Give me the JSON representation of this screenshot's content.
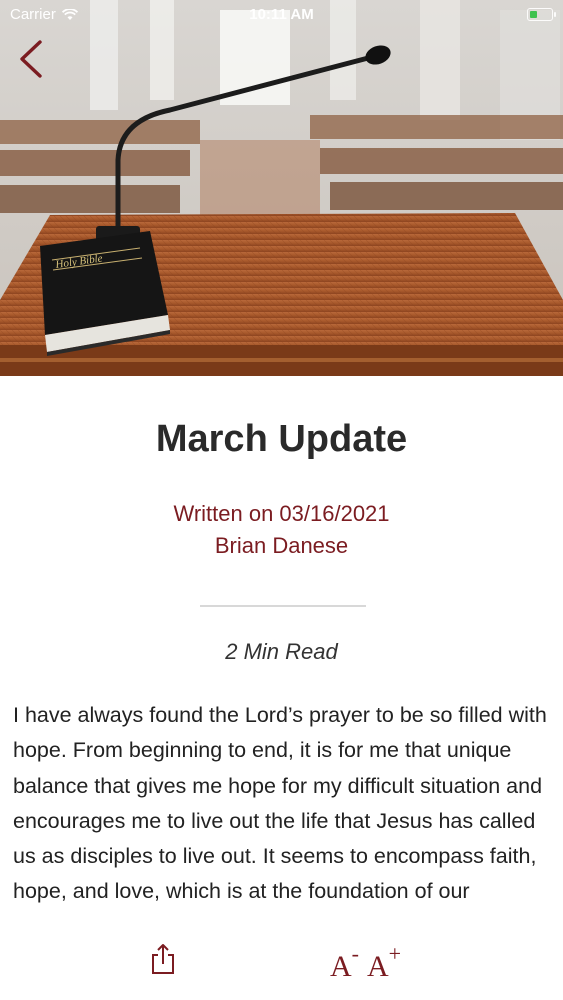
{
  "status_bar": {
    "carrier": "Carrier",
    "time": "10:11 AM",
    "battery_color": "#3fc24f"
  },
  "hero": {
    "book_label": "Holy Bible"
  },
  "article": {
    "title": "March Update",
    "written_on": "Written on 03/16/2021",
    "author": "Brian Danese",
    "read_time": "2 Min Read",
    "body": "I have always found the Lord’s prayer to be so filled with hope. From beginning to end, it is for me that unique balance that gives me hope for my difficult situation and encourages me to live out the life that Jesus has called us as disciples to live out. It seems to encompass faith, hope, and love, which is at the foundation of our"
  },
  "toolbar": {
    "decrease_font": "A",
    "decrease_symbol": "-",
    "increase_font": "A",
    "increase_symbol": "+"
  },
  "colors": {
    "accent": "#7b1c21",
    "text": "#222222"
  },
  "icons": [
    "back-chevron-icon",
    "wifi-icon",
    "share-icon"
  ]
}
